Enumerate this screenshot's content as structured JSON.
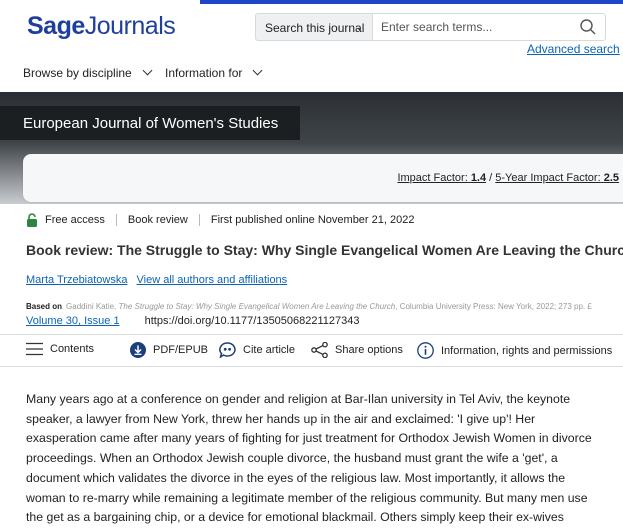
{
  "brand": {
    "name_bold": "Sage",
    "name_rest": "Journals"
  },
  "search": {
    "scope_label": "Search this journal",
    "placeholder": "Enter search terms...",
    "advanced_label": "Advanced search"
  },
  "nav": {
    "items": [
      {
        "label": "Browse by discipline"
      },
      {
        "label": "Information for"
      }
    ]
  },
  "journal": {
    "title": "European Journal of Women's Studies",
    "impact_factor_label": "Impact Factor:",
    "impact_factor_value": "1.4",
    "five_year_label": "5-Year Impact Factor:",
    "five_year_value": "2.5",
    "separator": " / "
  },
  "article": {
    "access": "Free access",
    "type": "Book review",
    "published": "First published online November 21, 2022",
    "title": "Book review: The Struggle to Stay: Why Single Evangelical Women Are Leaving the Church",
    "author": "Marta Trzebiatowska",
    "all_authors_label": "View all authors and affiliations",
    "based_on_label": "Based on",
    "based_on_author": "Gaddini Katie,",
    "based_on_title": "The Struggle to Stay: Why Single Evangelical Women Are Leaving the Church",
    "based_on_publisher": ", Columbia University Press: New York, 2022; 273 pp. £",
    "volume": "Volume 30, Issue 1",
    "doi": "https://doi.org/10.1177/13505068221127343"
  },
  "toolbar": {
    "contents": "Contents",
    "pdf": "PDF/EPUB",
    "cite": "Cite article",
    "share": "Share options",
    "info": "Information, rights and permissions"
  },
  "body": {
    "paragraph": "Many years ago at a conference on gender and religion at Bar-Ilan university in Tel Aviv, the keynote speaker, a lawyer from New York, threw her hands up in the air and exclaimed: 'I give up'! Her exasperation came after many years of fighting for just treatment for Orthodox Jewish Women in divorce proceedings. When an Orthodox Jewish couple divorce, the husband must grant the wife a 'get', a document which validates the divorce in the eyes of the religious law. Most importantly, it allows the woman to re-marry while remaining a legitimate member of the religious community. But many men use the get as a bargaining chip, or a device for emotional blackmail. Others simply keep their ex-wives symbolically tethered to them"
  },
  "colors": {
    "accent_blue": "#0b63b6",
    "logo_blue": "#1f3f9c",
    "banner_dark": "#1c1f22",
    "lock_green": "#2e8540"
  }
}
